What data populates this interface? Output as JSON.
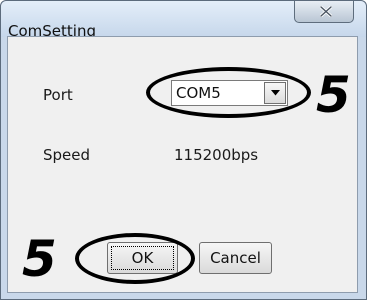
{
  "window": {
    "title": "ComSetting",
    "close_glyph": "X"
  },
  "form": {
    "port_label": "Port",
    "port_value": "COM5",
    "speed_label": "Speed",
    "speed_value": "115200bps"
  },
  "buttons": {
    "ok_label": "OK",
    "cancel_label": "Cancel"
  },
  "annotations": {
    "port_step": "5",
    "ok_step": "5"
  },
  "icons": [
    "close-icon",
    "chevron-down-icon"
  ]
}
